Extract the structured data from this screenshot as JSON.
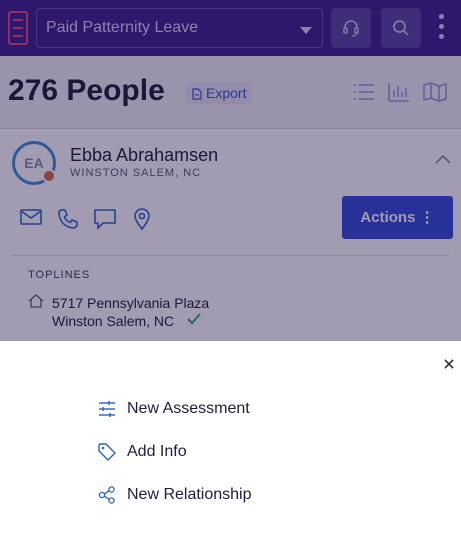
{
  "header": {
    "campaign_selected": "Paid Patternity Leave",
    "icons": [
      "app-logo-icon",
      "headset-icon",
      "search-icon",
      "kebab-menu-icon"
    ]
  },
  "list": {
    "count_label": "276 People",
    "export_label": "Export",
    "view_icons": [
      "list-view-icon",
      "chart-view-icon",
      "map-view-icon"
    ]
  },
  "person": {
    "initials": "EA",
    "name": "Ebba Abrahamsen",
    "location": "WINSTON SALEM, NC",
    "actions_label": "Actions ⋮",
    "contact_icons": [
      "email-icon",
      "phone-icon",
      "message-icon",
      "location-pin-icon"
    ]
  },
  "toplines": {
    "heading": "TOPLINES",
    "address_line1": "5717 Pennsylvania Plaza",
    "address_line2": "Winston Salem, NC"
  },
  "action_sheet": {
    "items": [
      {
        "label": "New Assessment",
        "icon": "sliders-icon"
      },
      {
        "label": "Add Info",
        "icon": "tag-icon"
      },
      {
        "label": "New Relationship",
        "icon": "share-nodes-icon"
      }
    ]
  },
  "colors": {
    "header_bg": "#3a1d8c",
    "primary_button": "#2e48d6",
    "icon_blue": "#2a62c8",
    "verified_green": "#2aa85a"
  }
}
